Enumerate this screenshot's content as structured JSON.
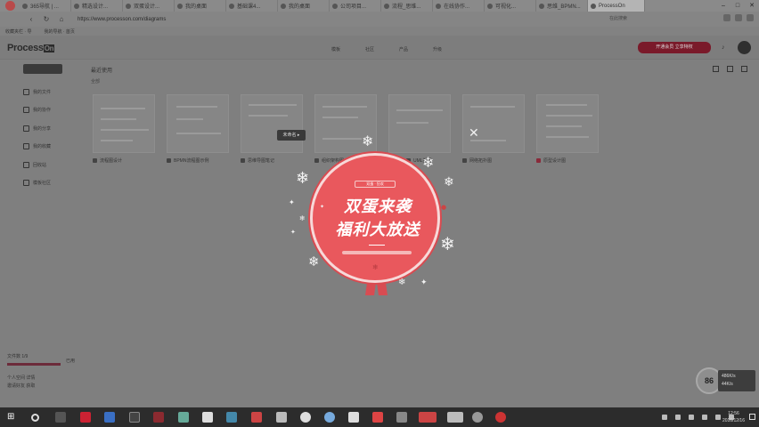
{
  "browser": {
    "tabs": [
      {
        "label": "365导航 | ...",
        "active": false
      },
      {
        "label": "精选设计...",
        "active": false
      },
      {
        "label": "双蛋设计...",
        "active": false
      },
      {
        "label": "我的桌面",
        "active": false
      },
      {
        "label": "基础课4...",
        "active": false
      },
      {
        "label": "我的桌面",
        "active": false
      },
      {
        "label": "公司项目...",
        "active": false
      },
      {
        "label": "流程_思维...",
        "active": false
      },
      {
        "label": "在线协作...",
        "active": false
      },
      {
        "label": "可视化...",
        "active": false
      },
      {
        "label": "思维_BPMN...",
        "active": false
      },
      {
        "label": "ProcessOn",
        "active": true
      }
    ],
    "url": "https://www.processon.com/diagrams",
    "search_placeholder": "在此搜索",
    "bookmarks": [
      "收藏夹栏 · 导",
      "我的导航 · 首页"
    ]
  },
  "app": {
    "logo_text": "Process",
    "logo_badge": "On",
    "nav_links": [
      "模板",
      "社区",
      "产品",
      "升级"
    ],
    "upgrade_label": "开通会员 立享特权",
    "sidebar": {
      "new_label": "新建",
      "items": [
        "我的文件",
        "我的协作",
        "我的分享",
        "我的收藏",
        "回收站",
        "模板社区"
      ]
    },
    "section_title": "最近使用",
    "section_sub": "全部",
    "files": [
      {
        "name": "流程图设计"
      },
      {
        "name": "BPMN流程图示例"
      },
      {
        "name": "思维导图笔记"
      },
      {
        "name": "组织架构图"
      },
      {
        "name": "UML类图"
      },
      {
        "name": "网络拓扑图"
      },
      {
        "name": "原型设计图"
      }
    ],
    "tooltip_label": "未命名 ▸",
    "storage": {
      "label": "文件数 1/9",
      "used": "已用",
      "meta_line1": "个人空间  详情",
      "meta_line2": "邀请好友  获取"
    }
  },
  "widget": {
    "percent": "86",
    "up": "486K/s",
    "down": "44K/s"
  },
  "promo": {
    "tag": "双蛋 · 狂欢",
    "line1": "双蛋来袭",
    "line2": "福利大放送",
    "close_icon": "✕",
    "accent_color": "#e9585d"
  },
  "taskbar": {
    "time": "12:56",
    "date": "2016/12/16"
  }
}
